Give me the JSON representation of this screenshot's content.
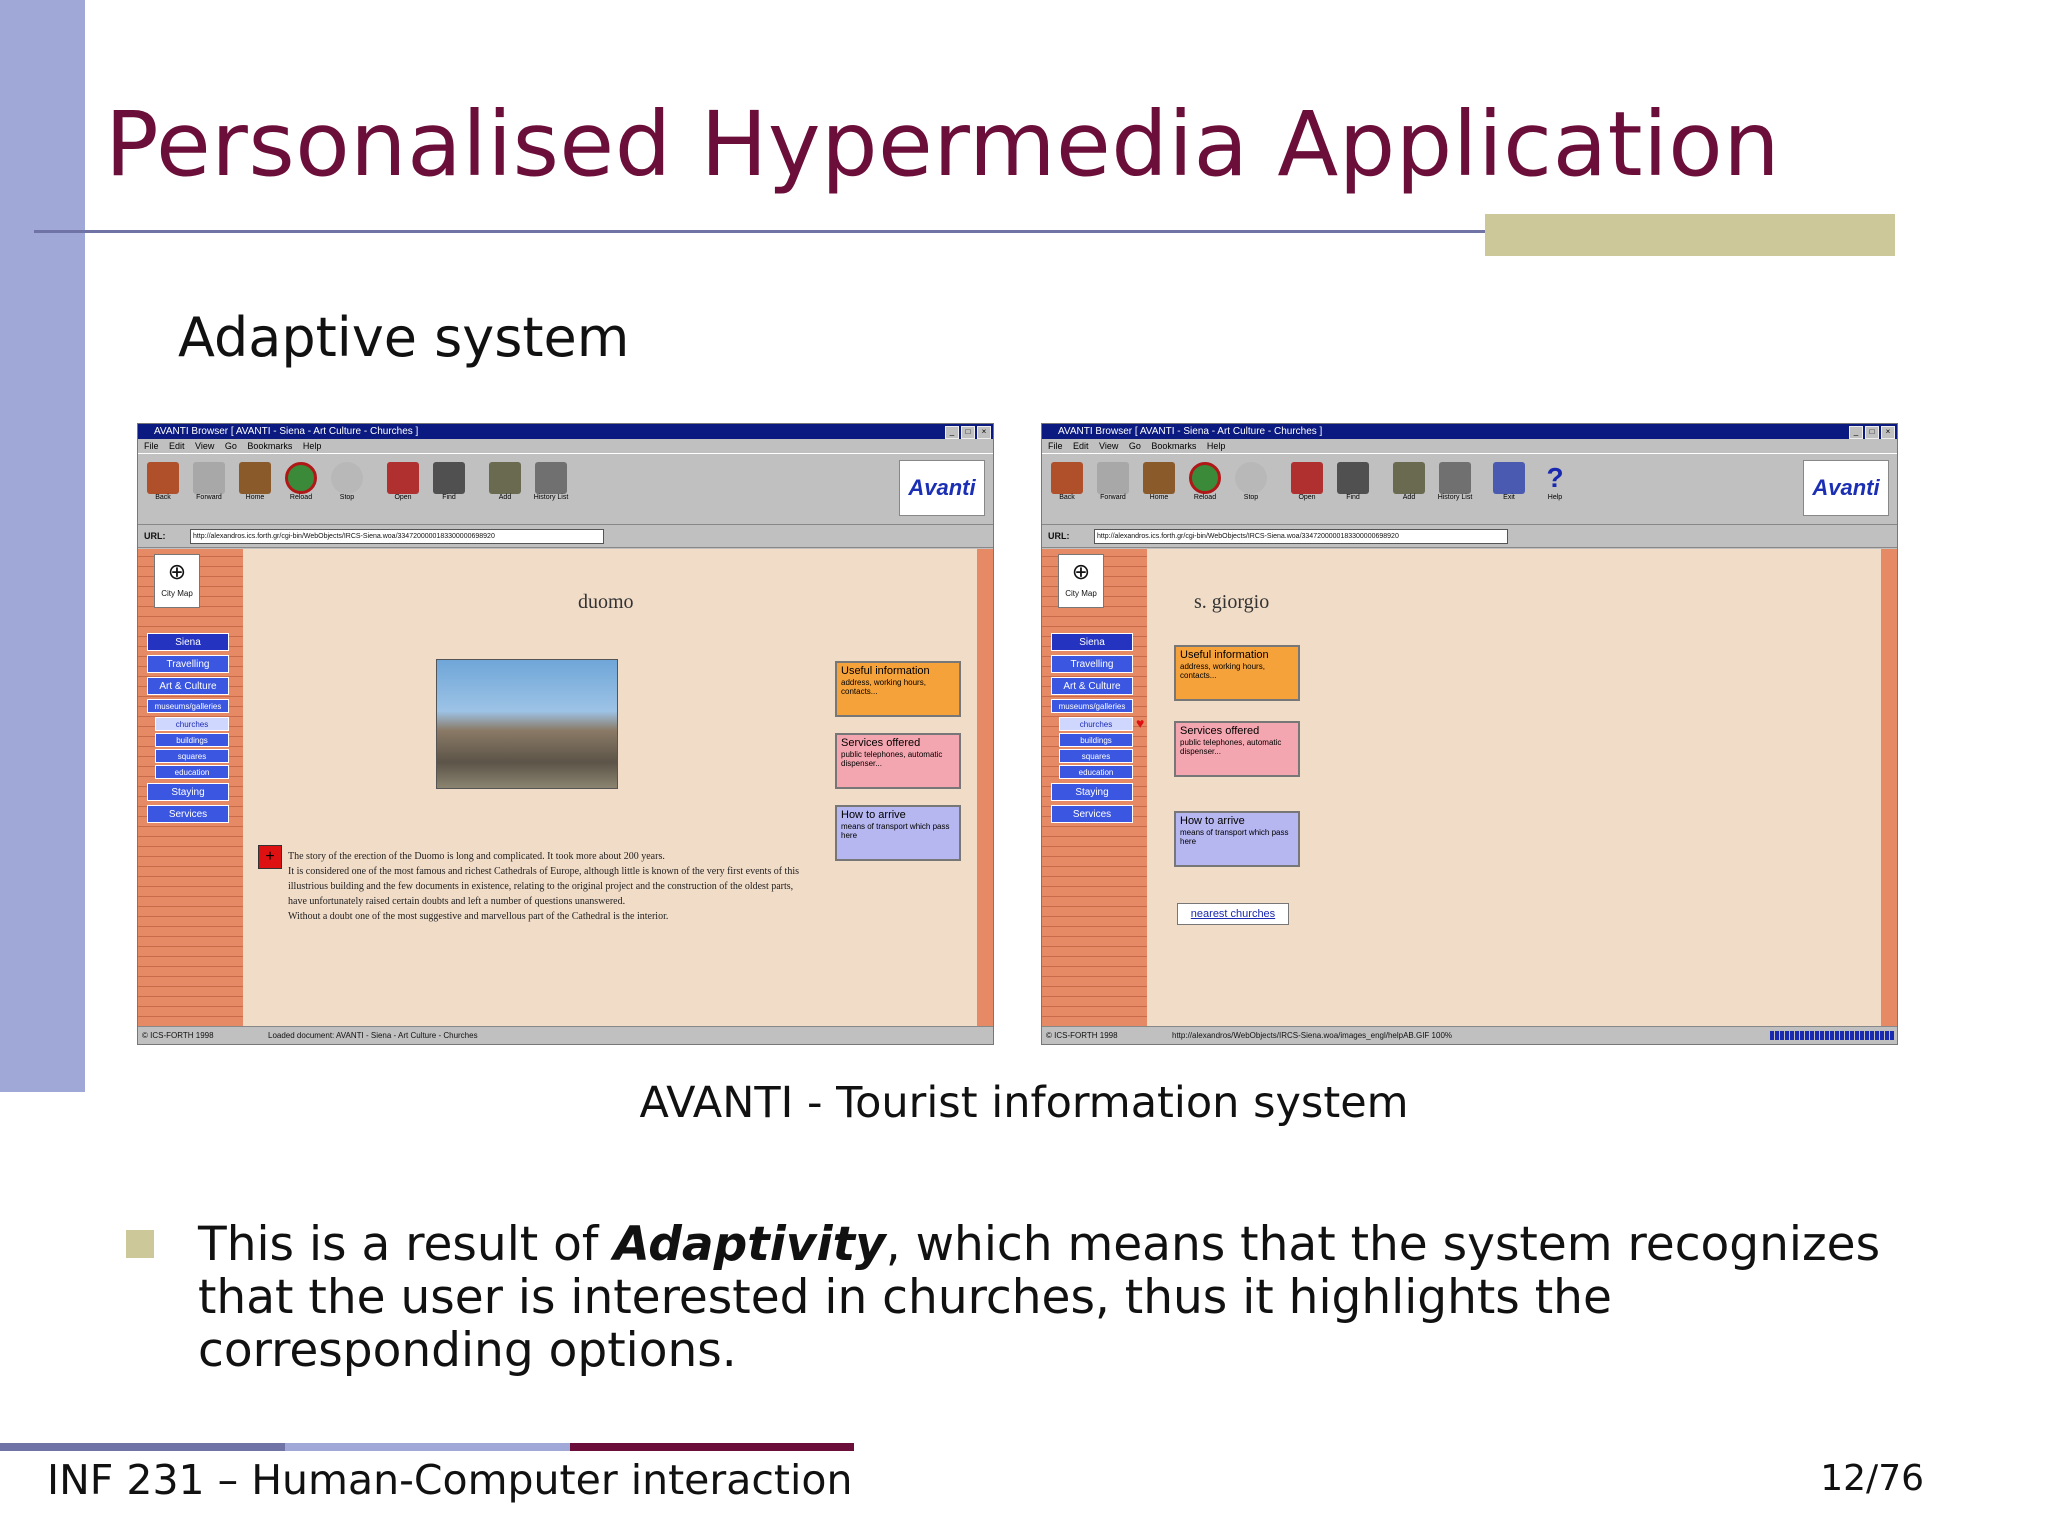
{
  "slide": {
    "title": "Personalised Hypermedia Application",
    "subtitle": "Adaptive system",
    "caption": "AVANTI - Tourist information system",
    "bullet_prefix": "This is a result of ",
    "bullet_emphasis": "Adaptivity",
    "bullet_suffix": ", which means that the system recognizes that the user is interested in churches, thus it highlights the corresponding options.",
    "footer": "INF 231 – Human-Computer interaction",
    "page_number": "12/76"
  },
  "colors": {
    "title": "#6b0f3a",
    "left_bar": "#9fa8d6",
    "accent": "#ccc89a",
    "footer_segments": [
      "#6f73a6",
      "#9fa8d6",
      "#6b0f3a"
    ]
  },
  "screens": {
    "left": {
      "window_title": "AVANTI Browser [ AVANTI - Siena - Art Culture - Churches ]",
      "menu": "File Edit View Go Bookmarks Help",
      "toolbar": [
        {
          "label": "Back",
          "icon": "back-icon"
        },
        {
          "label": "Forward",
          "icon": "forward-icon"
        },
        {
          "label": "Home",
          "icon": "home-icon"
        },
        {
          "label": "Reload",
          "icon": "reload-icon"
        },
        {
          "label": "Stop",
          "icon": "stop-icon"
        },
        {
          "label": "Open",
          "icon": "open-icon"
        },
        {
          "label": "Find",
          "icon": "find-icon"
        },
        {
          "label": "Add",
          "icon": "add-icon"
        },
        {
          "label": "History List",
          "icon": "history-icon"
        }
      ],
      "logo": "Avanti",
      "url_label": "URL:",
      "url": "http://alexandros.ics.forth.gr/cgi-bin/WebObjects/IRCS-Siena.woa/3347200000183300000698920",
      "city_map": "City Map",
      "nav": [
        "Siena",
        "Travelling",
        "Art & Culture",
        "museums/galleries",
        "churches",
        "buildings",
        "squares",
        "education",
        "Staying",
        "Services"
      ],
      "heading": "duomo",
      "boxes": [
        {
          "title": "Useful information",
          "text": "address, working hours, contacts..."
        },
        {
          "title": "Services offered",
          "text": "public telephones, automatic dispenser..."
        },
        {
          "title": "How to arrive",
          "text": "means of transport which pass here"
        }
      ],
      "story": [
        "The story of the erection of the Duomo is long and complicated. It took more about 200 years.",
        "It is considered one of the most famous and richest Cathedrals of Europe, although little is known of the very first events of this illustrious building and the few documents in existence, relating to the original project and the construction of the oldest parts, have unfortunately raised certain doubts and left a number of questions unanswered.",
        "Without a doubt one of the most suggestive and marvellous part of the Cathedral is the interior."
      ],
      "status_left": "© ICS-FORTH 1998",
      "status_text": "Loaded document: AVANTI - Siena - Art Culture - Churches"
    },
    "right": {
      "window_title": "AVANTI Browser [ AVANTI - Siena - Art Culture - Churches ]",
      "menu": "File Edit View Go Bookmarks Help",
      "toolbar": [
        {
          "label": "Back",
          "icon": "back-icon"
        },
        {
          "label": "Forward",
          "icon": "forward-icon"
        },
        {
          "label": "Home",
          "icon": "home-icon"
        },
        {
          "label": "Reload",
          "icon": "reload-icon"
        },
        {
          "label": "Stop",
          "icon": "stop-icon"
        },
        {
          "label": "Open",
          "icon": "open-icon"
        },
        {
          "label": "Find",
          "icon": "find-icon"
        },
        {
          "label": "Add",
          "icon": "add-icon"
        },
        {
          "label": "History List",
          "icon": "history-icon"
        },
        {
          "label": "Exit",
          "icon": "exit-icon"
        },
        {
          "label": "Help",
          "icon": "help-icon"
        }
      ],
      "logo": "Avanti",
      "url_label": "URL:",
      "url": "http://alexandros.ics.forth.gr/cgi-bin/WebObjects/IRCS-Siena.woa/3347200000183300000698920",
      "city_map": "City Map",
      "nav": [
        "Siena",
        "Travelling",
        "Art & Culture",
        "museums/galleries",
        "churches",
        "buildings",
        "squares",
        "education",
        "Staying",
        "Services"
      ],
      "heading": "s. giorgio",
      "boxes": [
        {
          "title": "Useful information",
          "text": "address, working hours, contacts..."
        },
        {
          "title": "Services offered",
          "text": "public telephones, automatic dispenser..."
        },
        {
          "title": "How to arrive",
          "text": "means of transport which pass here"
        }
      ],
      "nearest": "nearest churches",
      "status_left": "© ICS-FORTH 1998",
      "status_text": "http://alexandros/WebObjects/IRCS-Siena.woa/images_engl/helpAB.GIF 100%"
    }
  }
}
